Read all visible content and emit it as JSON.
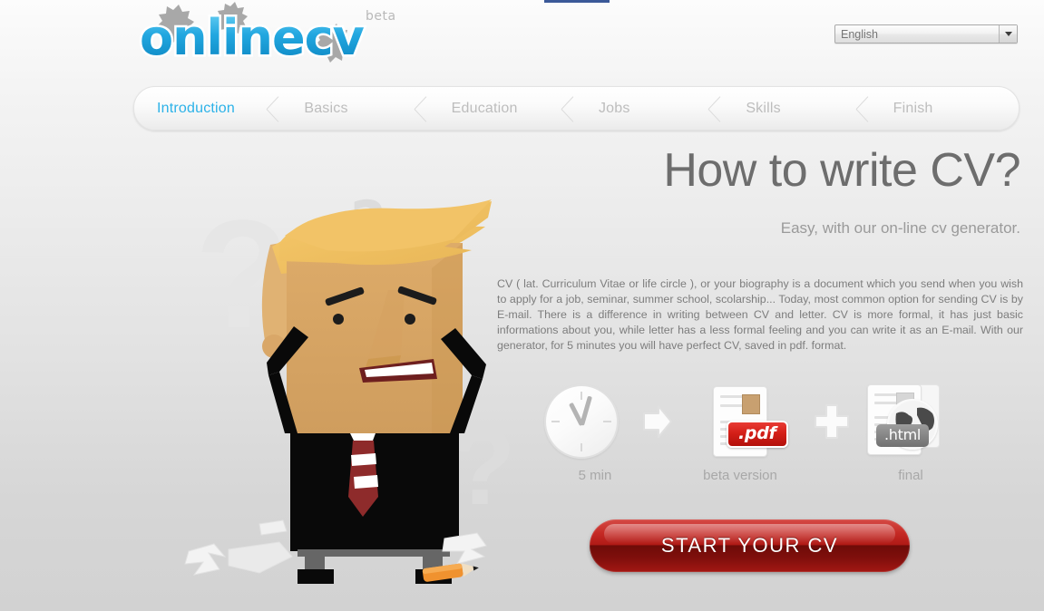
{
  "brand": {
    "logo_text": "onlinecv",
    "logo_beta": "beta",
    "accent_color": "#29abe2",
    "cta_color": "#c11f1a"
  },
  "header": {
    "language_select": {
      "value": "English",
      "options": [
        "English"
      ],
      "arrow_icon": "chevron-down-icon"
    }
  },
  "wizard": {
    "steps": [
      {
        "label": "Introduction",
        "active": true
      },
      {
        "label": "Basics",
        "active": false
      },
      {
        "label": "Education",
        "active": false
      },
      {
        "label": "Jobs",
        "active": false
      },
      {
        "label": "Skills",
        "active": false
      },
      {
        "label": "Finish",
        "active": false
      }
    ]
  },
  "main": {
    "title": "How to write CV?",
    "subtitle": "Easy, with our on-line cv generator.",
    "paragraph": "CV ( lat. Curriculum Vitae or life circle ), or your biography is a document which you send when you wish to apply for a job, seminar, summer school, scolarship... Today, most common option for sending CV is by E-mail. There is a difference in writing between CV and letter. CV is more formal, it has just basic informations about you, while letter has a less formal feeling and you can write it as an E-mail. With our generator, for 5 minutes you will have perfect CV, saved in pdf. format.",
    "steps_row": [
      {
        "icon": "clock-icon",
        "caption": "5 min"
      },
      {
        "icon": "arrow-right-icon",
        "caption": ""
      },
      {
        "icon": "pdf-document-icon",
        "caption": "beta version",
        "badge": ".pdf"
      },
      {
        "icon": "plus-icon",
        "caption": ""
      },
      {
        "icon": "html-document-globe-icon",
        "caption": "final",
        "badge": ".html"
      }
    ],
    "cta_label": "START YOUR CV"
  },
  "illustration": {
    "name": "frustrated-businessman-illustration",
    "watermark_glyph": "?"
  }
}
